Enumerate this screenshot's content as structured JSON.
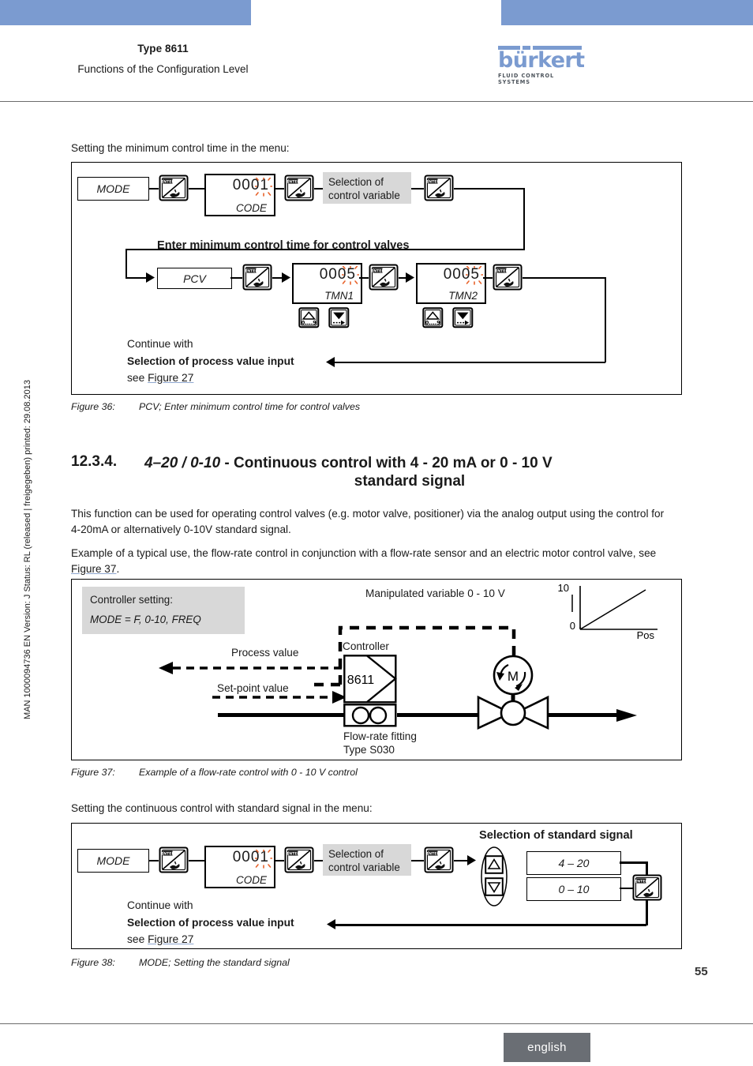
{
  "header": {
    "type_line": "Type 8611",
    "subtitle": "Functions of the Configuration Level",
    "logo_word": "bürkert",
    "logo_tagline": "FLUID CONTROL SYSTEMS"
  },
  "sidebar_text": "MAN 1000094736  EN  Version: J  Status: RL (released | freigegeben)  printed: 29.08.2013",
  "footer": {
    "language": "english",
    "page_number": "55"
  },
  "intro_fig36": "Setting the minimum control time in the menu:",
  "figure36": {
    "mode_label": "MODE",
    "code_value": "0001",
    "code_label": "CODE",
    "selection_box": "Selection of\ncontrol variable",
    "selection_line1": "Selection of",
    "selection_line2": "control variable",
    "section_title": "Enter minimum control time for control valves",
    "pcv_label": "PCV",
    "tmn1_value": "0005",
    "tmn1_label": "TMN1",
    "tmn2_value": "0005",
    "tmn2_label": "TMN2",
    "continue_line1": "Continue with",
    "continue_line2": "Selection of process value input",
    "continue_line3_pre": "see ",
    "continue_line3_link": "Figure 27",
    "enter_btn_label": "ENTER",
    "up_btn_label": "0....9"
  },
  "caption36": {
    "number": "Figure 36:",
    "text": "PCV; Enter minimum control time for control valves"
  },
  "section": {
    "number": "12.3.4.",
    "title_italic": "4–20 / 0-10",
    "title_rest": " - Continuous control with 4 - 20 mA or 0 - 10 V",
    "title_line2": "standard signal"
  },
  "paragraphs": {
    "p1": "This function can be used for operating control valves (e.g. motor valve, positioner) via the analog output using the control for 4-20mA or alternatively 0-10V standard signal.",
    "p2_pre": "Example of a typical use, the flow-rate control in conjunction with a flow-rate sensor and an electric motor control valve, see ",
    "p2_link": "Figure 37",
    "p2_post": "."
  },
  "figure37": {
    "setting_line1": "Controller setting:",
    "setting_line2": "MODE = F, 0-10, FREQ",
    "manipulated_label": "Manipulated variable 0 - 10 V",
    "process_value": "Process value",
    "setpoint_value": "Set-point value",
    "controller_label": "Controller",
    "controller_type": "8611",
    "fitting_line1": "Flow-rate fitting",
    "fitting_line2": "Type S030",
    "motor_label": "M",
    "graph_ymax": "10",
    "graph_ymin": "0",
    "graph_xlabel": "Pos"
  },
  "caption37": {
    "number": "Figure 37:",
    "text": "Example of a flow-rate control with 0 - 10 V control"
  },
  "intro_fig38": "Setting the continuous control with standard signal in the menu:",
  "figure38": {
    "mode_label": "MODE",
    "code_value": "0001",
    "code_label": "CODE",
    "selection_line1": "Selection of",
    "selection_line2": "control variable",
    "std_signal_title": "Selection of standard signal",
    "option1": "4 – 20",
    "option2": "0 – 10",
    "continue_line1": "Continue with",
    "continue_line2": "Selection of process value input",
    "continue_line3_pre": "see ",
    "continue_line3_link": "Figure 27"
  },
  "caption38": {
    "number": "Figure 38:",
    "text": "MODE; Setting the standard signal"
  },
  "colors": {
    "brand_blue": "#7b9bd0",
    "grey_box": "#d8d8d8",
    "blink_orange": "#e8622a",
    "footer_grey": "#6a6e74"
  }
}
